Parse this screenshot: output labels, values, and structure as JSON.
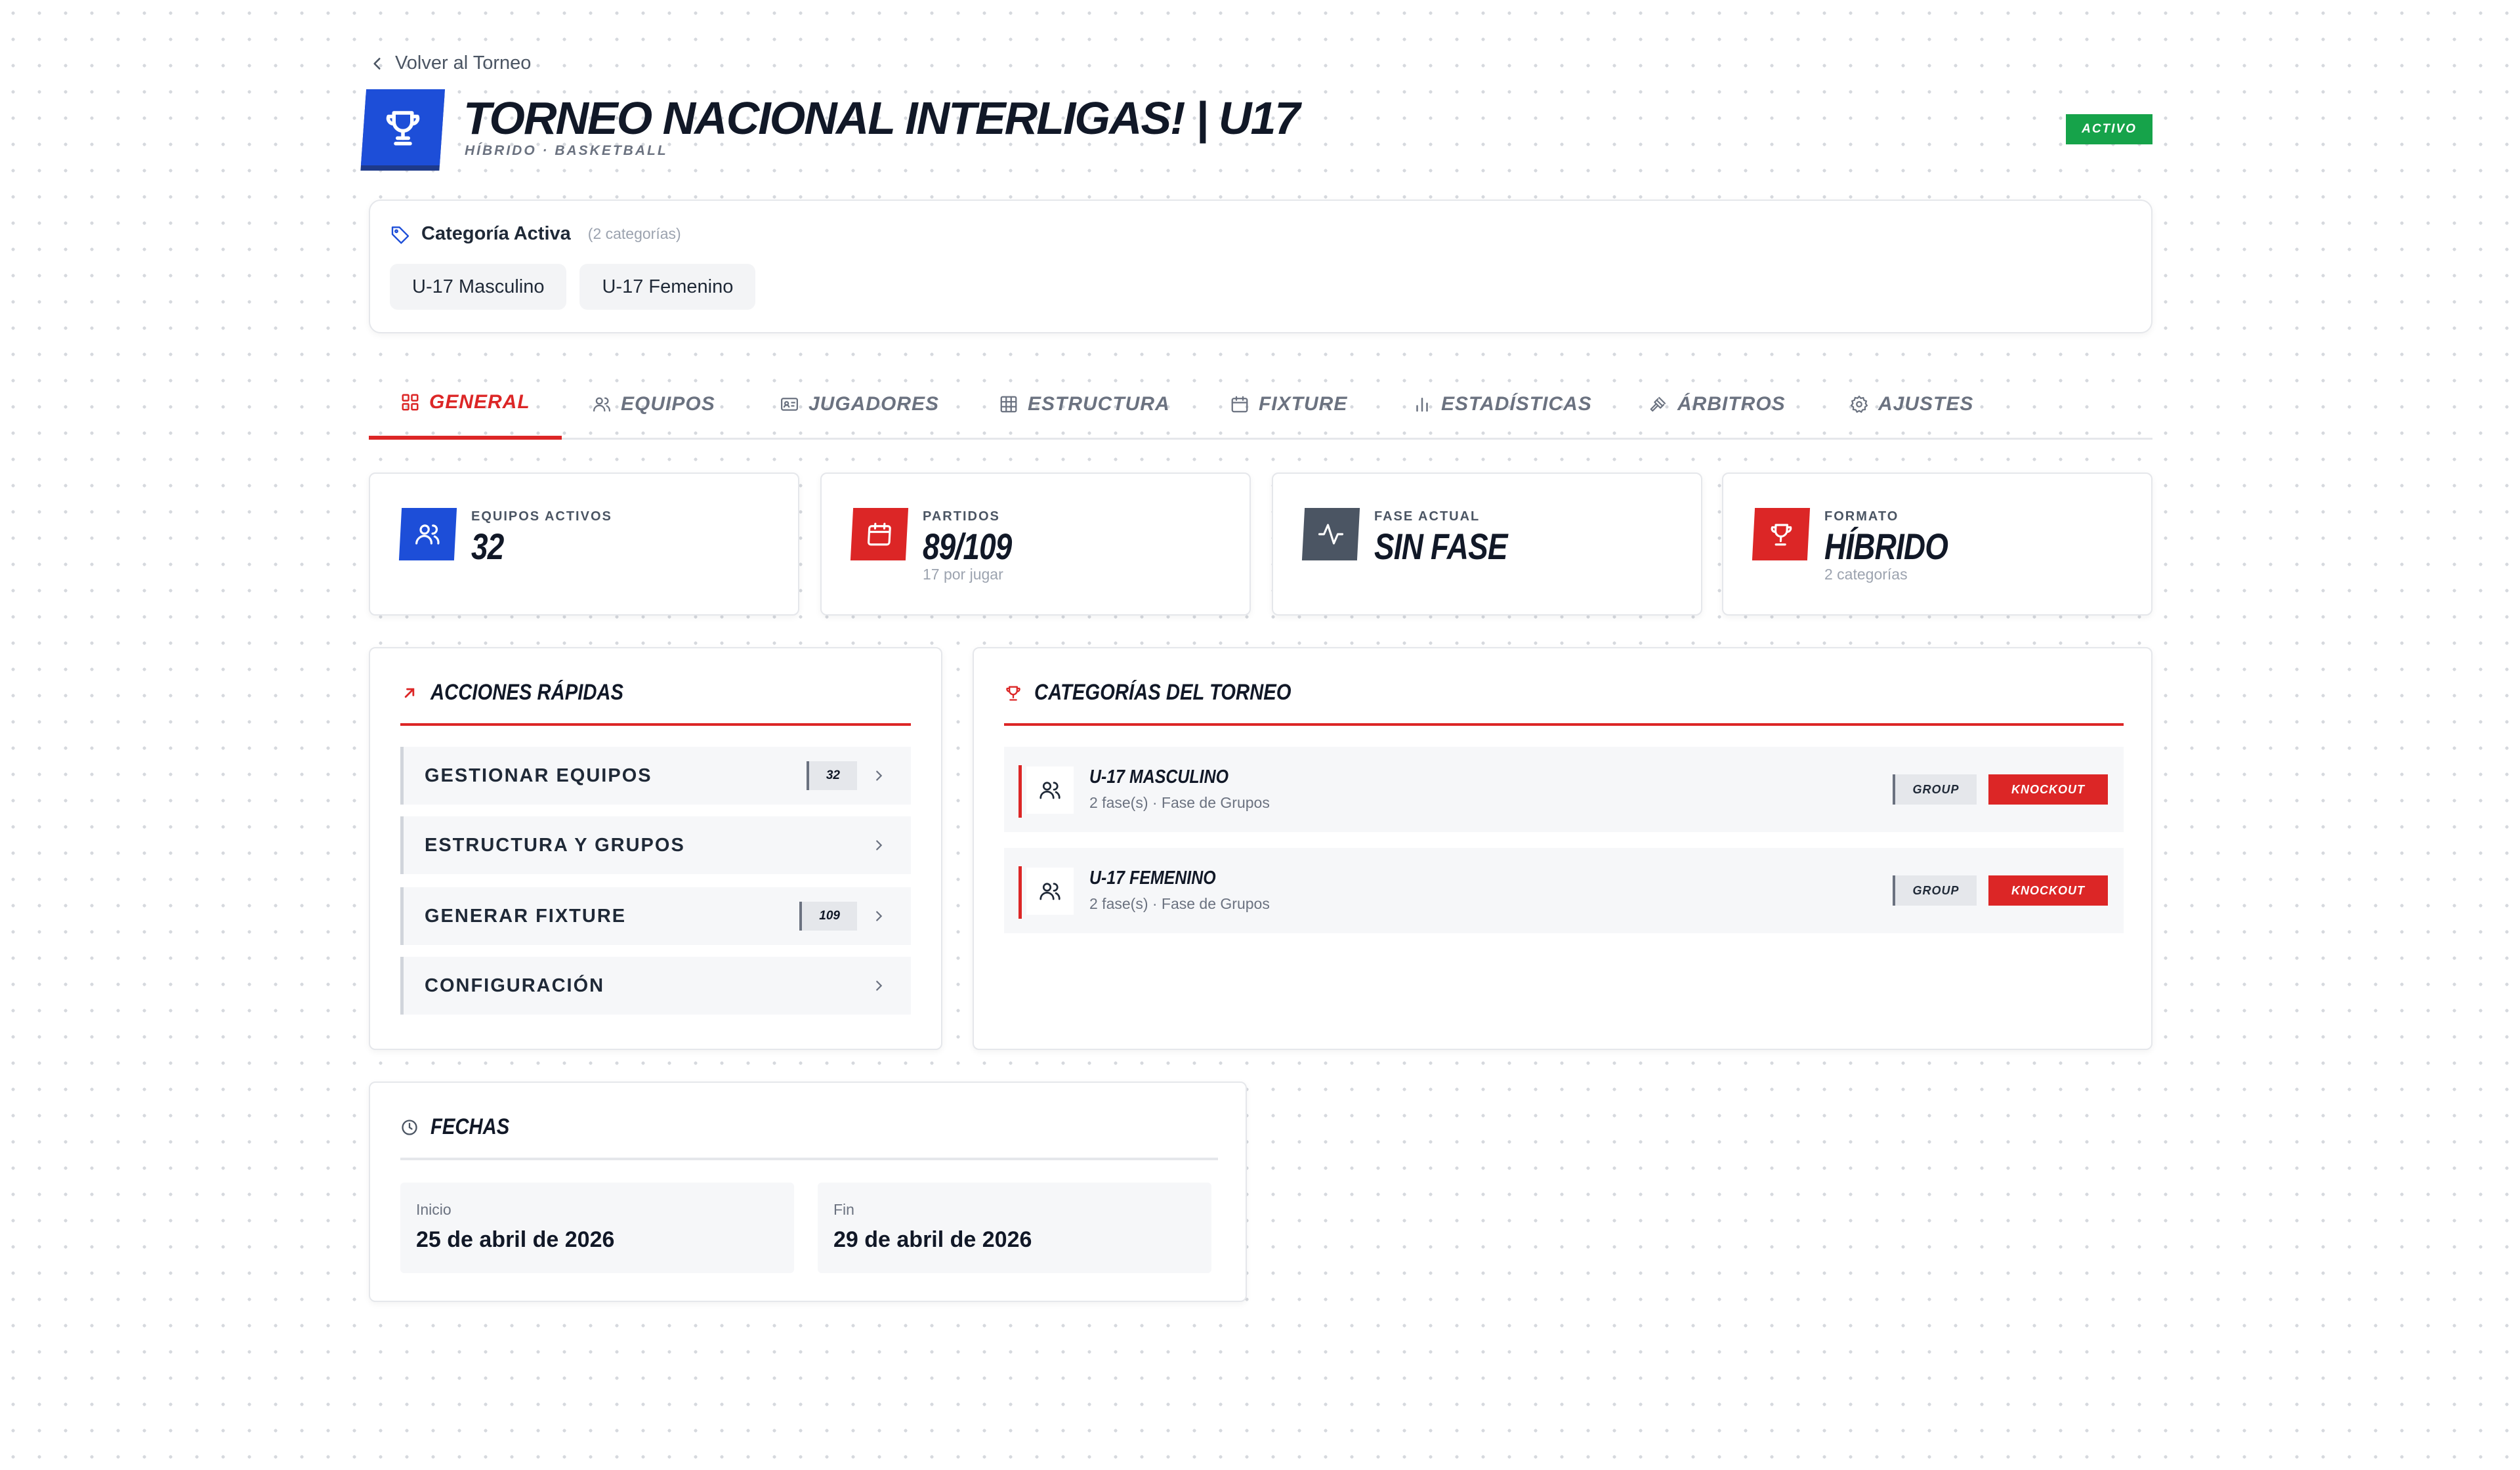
{
  "nav": {
    "back_label": "Volver al Torneo"
  },
  "tournament": {
    "title": "TORNEO NACIONAL INTERLIGAS! | U17",
    "subtitle": "HÍBRIDO · BASKETBALL",
    "status": "ACTIVO"
  },
  "categories": {
    "label": "Categoría Activa",
    "count": "(2 categorías)",
    "chips": [
      "U-17 Masculino",
      "U-17 Femenino"
    ]
  },
  "tabs": [
    {
      "label": "GENERAL",
      "icon": "grid-icon",
      "active": true
    },
    {
      "label": "EQUIPOS",
      "icon": "users-icon"
    },
    {
      "label": "JUGADORES",
      "icon": "id-card-icon"
    },
    {
      "label": "ESTRUCTURA",
      "icon": "table-icon"
    },
    {
      "label": "FIXTURE",
      "icon": "calendar-icon"
    },
    {
      "label": "ESTADÍSTICAS",
      "icon": "bar-chart-icon"
    },
    {
      "label": "ÁRBITROS",
      "icon": "gavel-icon"
    },
    {
      "label": "AJUSTES",
      "icon": "gear-icon"
    }
  ],
  "stats": [
    {
      "label": "EQUIPOS ACTIVOS",
      "value": "32",
      "sub": "",
      "icon": "users-icon",
      "color": "#1d4ed8"
    },
    {
      "label": "PARTIDOS",
      "value": "89/109",
      "sub": "17 por jugar",
      "icon": "calendar-icon",
      "color": "#dc2626"
    },
    {
      "label": "FASE ACTUAL",
      "value": "SIN FASE",
      "sub": "",
      "icon": "activity-icon",
      "color": "#4b5563"
    },
    {
      "label": "FORMATO",
      "value": "HÍBRIDO",
      "sub": "2 categorías",
      "icon": "trophy-icon",
      "color": "#dc2626"
    }
  ],
  "quick_actions": {
    "title": "ACCIONES RÁPIDAS",
    "items": [
      {
        "label": "GESTIONAR EQUIPOS",
        "count": "32"
      },
      {
        "label": "ESTRUCTURA Y GRUPOS",
        "count": ""
      },
      {
        "label": "GENERAR FIXTURE",
        "count": "109"
      },
      {
        "label": "CONFIGURACIÓN",
        "count": ""
      }
    ]
  },
  "tournament_categories": {
    "title": "CATEGORÍAS DEL TORNEO",
    "rows": [
      {
        "name": "U-17 MASCULINO",
        "desc": "2 fase(s) · Fase de Grupos",
        "tag1": "GROUP",
        "tag2": "KNOCKOUT"
      },
      {
        "name": "U-17 FEMENINO",
        "desc": "2 fase(s) · Fase de Grupos",
        "tag1": "GROUP",
        "tag2": "KNOCKOUT"
      }
    ]
  },
  "dates": {
    "title": "FECHAS",
    "start_label": "Inicio",
    "start_value": "25 de abril de 2026",
    "end_label": "Fin",
    "end_value": "29 de abril de 2026"
  },
  "colors": {
    "primary_red": "#dc2626",
    "primary_blue": "#1d4ed8",
    "active_green": "#16a34a"
  }
}
